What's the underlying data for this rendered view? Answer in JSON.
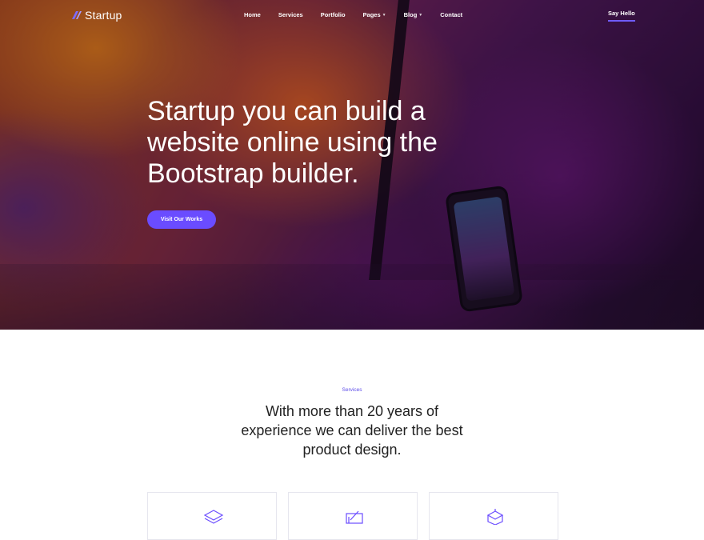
{
  "nav": {
    "logo_text": "Startup",
    "items": [
      {
        "label": "Home",
        "icon": ""
      },
      {
        "label": "Services",
        "icon": ""
      },
      {
        "label": "Portfolio",
        "icon": ""
      },
      {
        "label": "Pages",
        "icon": "chevron-down-icon"
      },
      {
        "label": "Blog",
        "icon": "chevron-down-icon"
      },
      {
        "label": "Contact",
        "icon": ""
      }
    ],
    "cta_label": "Say Hello"
  },
  "hero": {
    "title": "Startup you can build a website online using the Bootstrap builder.",
    "button_label": "Visit Our Works"
  },
  "services": {
    "eyebrow": "Services",
    "title": "With more than 20 years of experience we can deliver the best product design.",
    "cards": [
      {
        "icon": "layers-icon"
      },
      {
        "icon": "design-tools-icon"
      },
      {
        "icon": "box-icon"
      }
    ]
  },
  "colors": {
    "accent": "#6a4cff",
    "eyebrow": "#5a49e8",
    "text_dark": "#222222"
  }
}
